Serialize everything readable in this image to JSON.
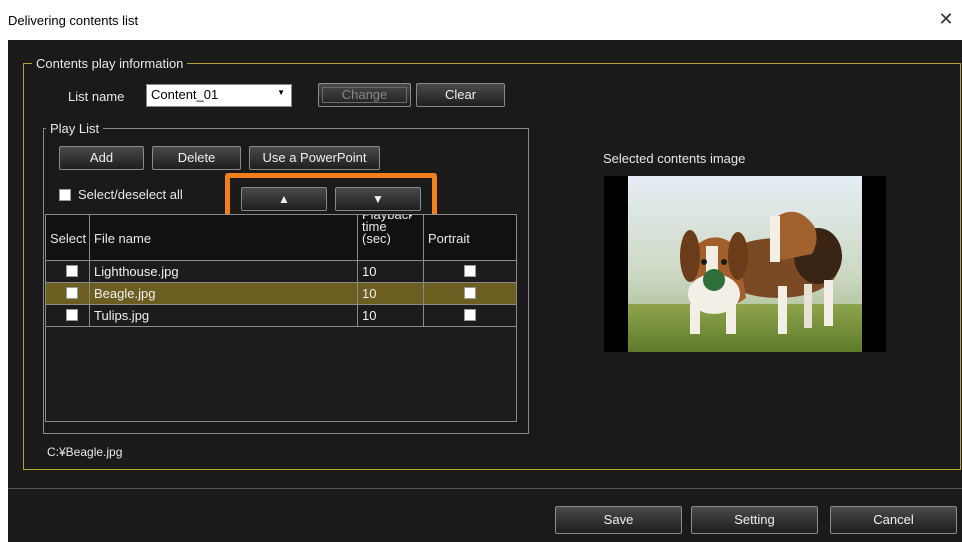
{
  "window": {
    "title": "Delivering contents list",
    "close_glyph": "✕"
  },
  "info_frame": {
    "legend": "Contents play information"
  },
  "list_name": {
    "label": "List name",
    "value": "Content_01",
    "arrow": "▼"
  },
  "buttons": {
    "change": "Change",
    "clear": "Clear",
    "add": "Add",
    "delete": "Delete",
    "powerpoint": "Use a PowerPoint",
    "up": "▲",
    "down": "▼",
    "save": "Save",
    "setting": "Setting",
    "cancel": "Cancel"
  },
  "playlist": {
    "legend": "Play List",
    "select_all": "Select/deselect all",
    "columns": {
      "select": "Select",
      "file_name": "File name",
      "playback_time": "Playback time (sec)",
      "portrait": "Portrait"
    },
    "rows": [
      {
        "file": "Lighthouse.jpg",
        "time": "10",
        "selected": false
      },
      {
        "file": "Beagle.jpg",
        "time": "10",
        "selected": true
      },
      {
        "file": "Tulips.jpg",
        "time": "10",
        "selected": false
      }
    ]
  },
  "file_path": "C:¥Beagle.jpg",
  "preview": {
    "label": "Selected contents image"
  },
  "colors": {
    "dialog_bg": "#1a1a1a",
    "frame_border": "#b8a030",
    "highlight": "#f27f1b",
    "selected_row": "#6b5e20"
  }
}
